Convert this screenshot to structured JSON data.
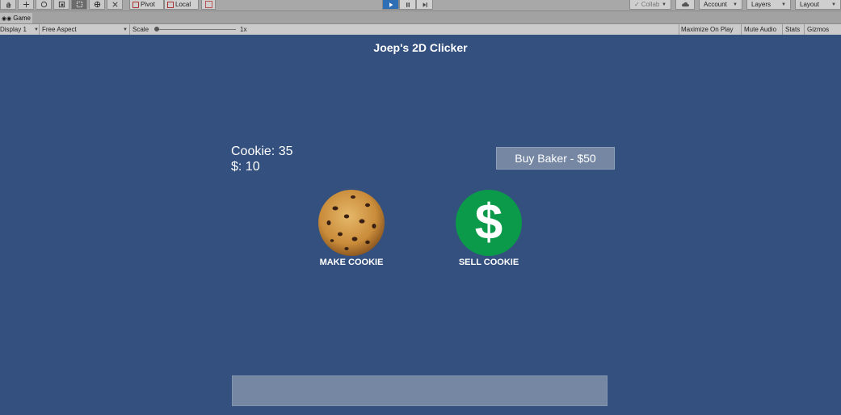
{
  "toolbar": {
    "pivot_label": "Pivot",
    "local_label": "Local",
    "collab_label": "Collab",
    "account_label": "Account",
    "layers_label": "Layers",
    "layout_label": "Layout",
    "play_color": "#2f6fb5"
  },
  "tab": {
    "label": "Game"
  },
  "viewbar": {
    "display": "Display 1",
    "aspect": "Free Aspect",
    "scale_label": "Scale",
    "scale_value": "1x",
    "maximize": "Maximize On Play",
    "mute": "Mute Audio",
    "stats": "Stats",
    "gizmos": "Gizmos"
  },
  "game": {
    "title": "Joep's 2D Clicker",
    "cookie_stat": "Cookie: 35",
    "money_stat": "$: 10",
    "buy_button": "Buy Baker - $50",
    "make_label": "MAKE COOKIE",
    "sell_label": "SELL COOKIE",
    "background": "#33507e",
    "sell_color": "#0b9a4a"
  }
}
